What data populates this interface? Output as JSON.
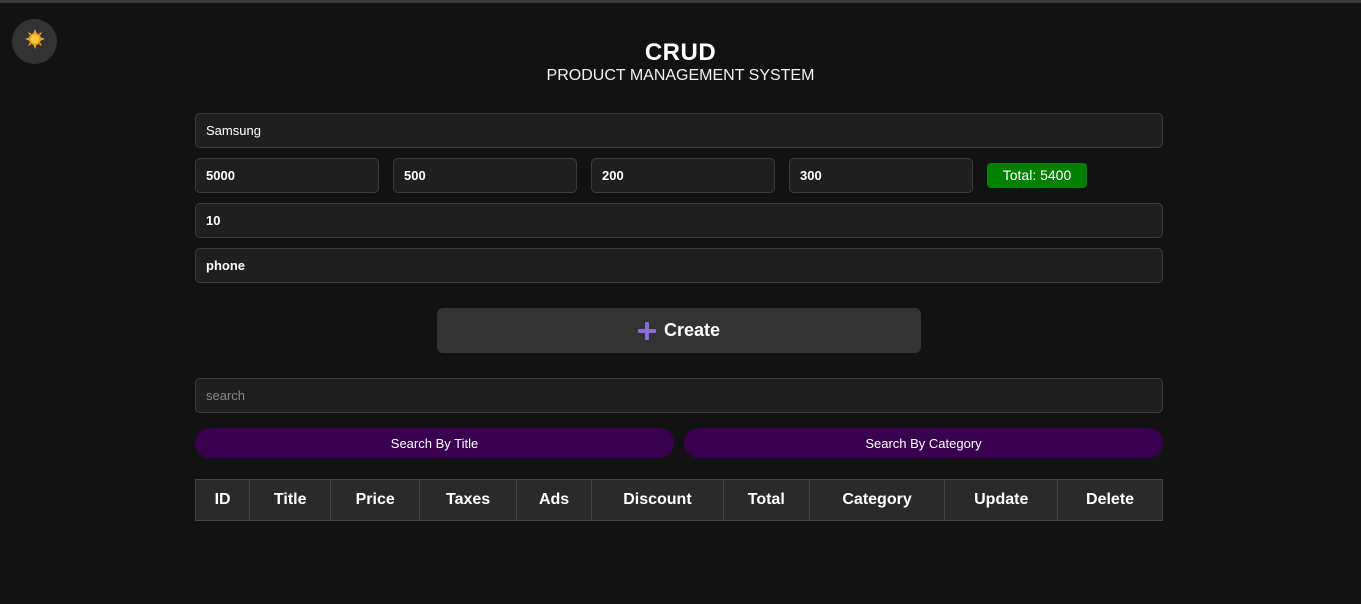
{
  "theme_toggle": {
    "icon": "sun-icon",
    "color": "#f5a623"
  },
  "header": {
    "title": "CRUD",
    "subtitle": "PRODUCT MANAGEMENT SYSTEM"
  },
  "form": {
    "title_value": "Samsung",
    "price_value": "5000",
    "taxes_value": "500",
    "ads_value": "200",
    "discount_value": "300",
    "total_label": "Total: 5400",
    "count_value": "10",
    "category_value": "phone",
    "create_label": "Create",
    "create_icon": "plus-icon",
    "accent": "#8a6bdc",
    "total_color": "#008000"
  },
  "search": {
    "placeholder": "search",
    "by_title_label": "Search By Title",
    "by_category_label": "Search By Category",
    "button_color": "#39004f"
  },
  "table": {
    "headers": [
      "ID",
      "Title",
      "Price",
      "Taxes",
      "Ads",
      "Discount",
      "Total",
      "Category",
      "Update",
      "Delete"
    ]
  }
}
